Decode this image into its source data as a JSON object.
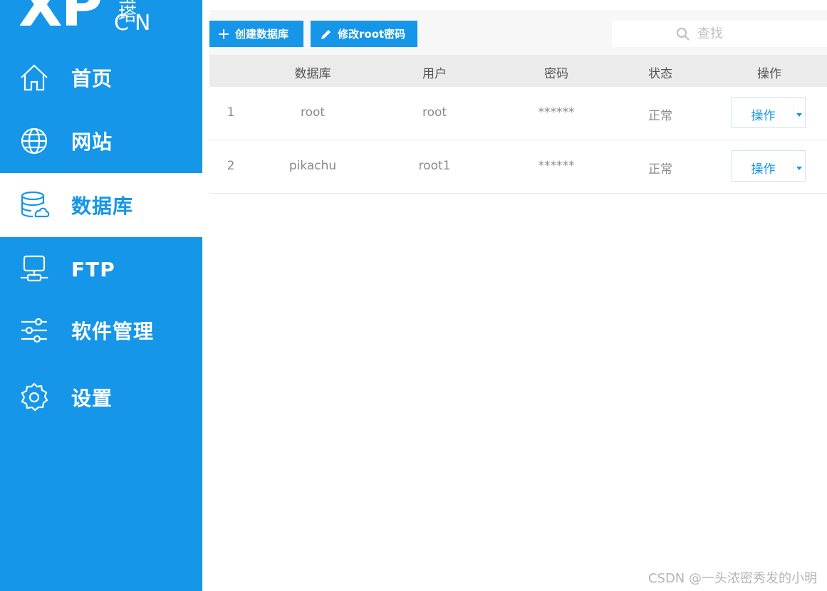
{
  "logo": {
    "main": "XP",
    "sub": "CN",
    "chars": "宝塔"
  },
  "sidebar": {
    "items": [
      {
        "label": "首页",
        "icon": "home-icon"
      },
      {
        "label": "网站",
        "icon": "globe-icon"
      },
      {
        "label": "数据库",
        "icon": "database-icon",
        "active": true
      },
      {
        "label": "FTP",
        "icon": "ftp-server-icon"
      },
      {
        "label": "软件管理",
        "icon": "sliders-icon"
      },
      {
        "label": "设置",
        "icon": "gear-icon"
      }
    ]
  },
  "toolbar": {
    "create_label": "创建数据库",
    "modify_label": "修改root密码",
    "search_placeholder": "查找"
  },
  "table": {
    "columns": [
      "数据库",
      "用户",
      "密码",
      "状态",
      "操作"
    ],
    "rows": [
      {
        "index": "1",
        "database": "root",
        "user": "root",
        "password": "******",
        "status": "正常",
        "action": "操作"
      },
      {
        "index": "2",
        "database": "pikachu",
        "user": "root1",
        "password": "******",
        "status": "正常",
        "action": "操作"
      }
    ]
  },
  "watermark": "CSDN @一头浓密秀发的小明",
  "colors": {
    "accent": "#1596e8",
    "header_bg": "#ebebeb"
  }
}
